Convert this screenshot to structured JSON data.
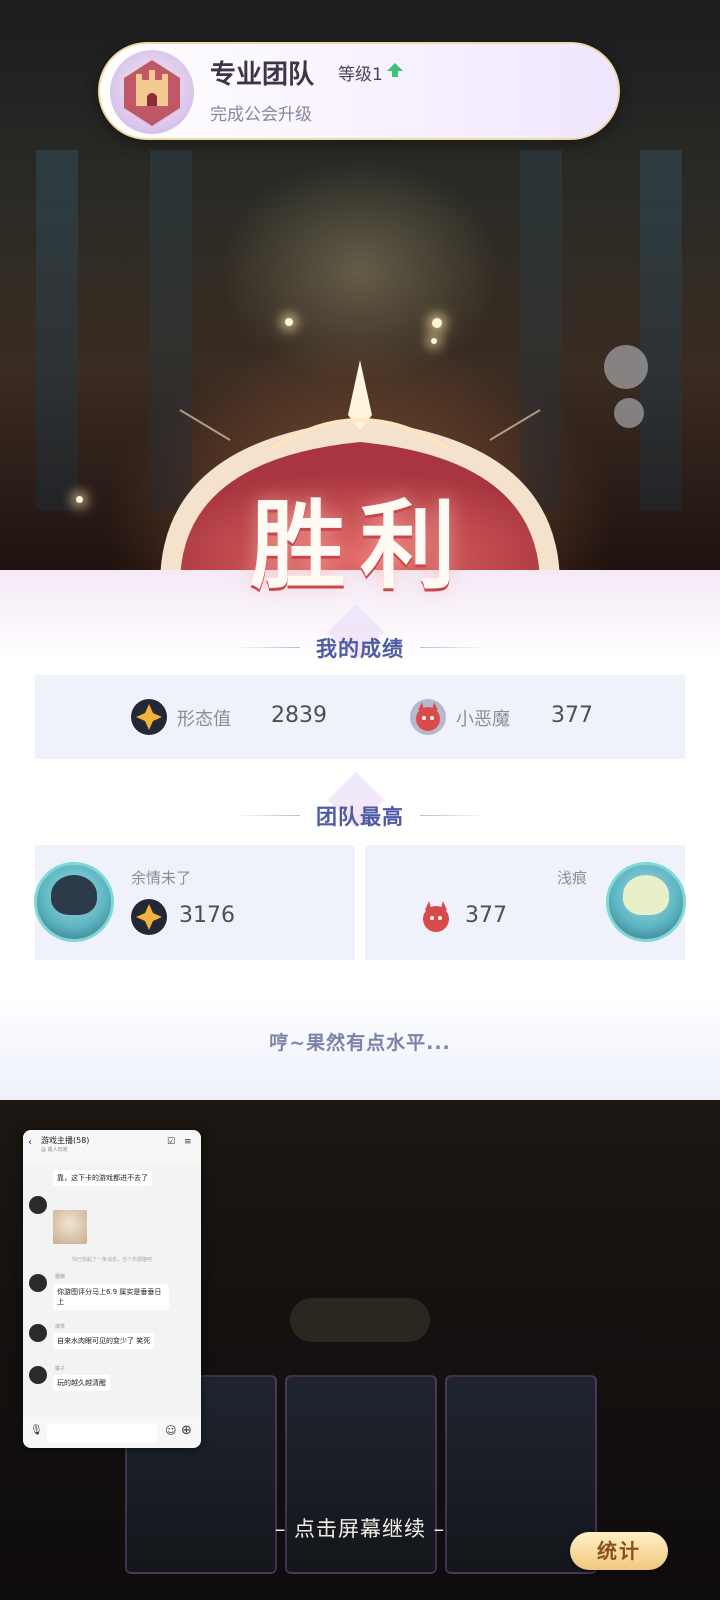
{
  "guild_banner": {
    "title": "专业团队",
    "level": "等级1",
    "subtitle": "完成公会升级",
    "level_arrow_color": "#3cc279"
  },
  "result": {
    "headline": "胜利"
  },
  "my_score": {
    "title": "我的成绩",
    "form_label": "形态值",
    "form_value": "2839",
    "imp_label": "小恶魔",
    "imp_value": "377"
  },
  "team_best": {
    "title": "团队最高",
    "left_player": {
      "name": "余情未了",
      "value": "3176",
      "icon": "star-gem-icon"
    },
    "right_player": {
      "name": "浅痕",
      "value": "377",
      "icon": "imp-icon"
    }
  },
  "taunt": "哼~果然有点水平...",
  "chat_overlay": {
    "title": "游戏主播(58)",
    "subtitle": "@ 成人玩家",
    "messages": [
      {
        "text": "靠，这下卡的游戏都进不去了"
      },
      {
        "name": "猫粮",
        "text": "你游图评分马上6.9 属实是垂垂日上"
      },
      {
        "name": "抹茶",
        "text": "自来水肉眼可见的变少了 笑死"
      },
      {
        "name": "橘子",
        "text": "玩的越久越清醒"
      }
    ],
    "system_notice": "你已收起了一条消息，当个布偶猫吧"
  },
  "continue_prompt": "– 点击屏幕继续 –",
  "stats_button": "统计",
  "colors": {
    "section_title": "#4d5aa6",
    "victory_red": "#c8484a",
    "panel_bg": "#eff2fb"
  }
}
